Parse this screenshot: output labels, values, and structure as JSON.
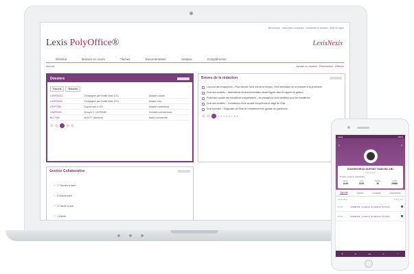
{
  "header": {
    "topline": "Bienvenue · Vous êtes connecté · Contacter le service · Aide en ligne",
    "brand_prefix": "Lexis ",
    "brand_product": "PolyOffice",
    "brand_tm": "®",
    "brand_right_prefix": "Lexis",
    "brand_right_suffix": "Nexis"
  },
  "nav": [
    "Général",
    "Dossier en cours",
    "Tâches",
    "Documentation",
    "Analyse",
    "Compléments"
  ],
  "subbar": {
    "left": "Accueil",
    "right": "Ajouter un module · Réinitialiser · Afficher"
  },
  "dossiers": {
    "title": "Dossiers",
    "tabs": [
      "Favoris",
      "Récents"
    ],
    "rows": [
      [
        "LXNF00001",
        "Compagnie par l'entité Mars (CS)",
        "Dossier courant"
      ],
      [
        "LXNF00002",
        "Compagnie par l'entité Mars (CS)",
        "Dossier clos"
      ],
      [
        "LPRF7000",
        "Dupont sarl c/ SCI",
        "Dossier contentieux"
      ],
      [
        "LXMF5000",
        "Groupe C. LEGRAND",
        "Contrats commerciaux"
      ],
      [
        "BLT7000",
        "MOUTT (Mention)",
        "Statut commercial"
      ]
    ]
  },
  "breves": {
    "title": "Brèves de la rédaction",
    "items": [
      "L'accord des employeurs – Pour assurer l'avis lors de la réunion, il est nécessaire de se préparer à la procédure",
      "Droit des sociétés – Informations environnementales devant figurer dans le rapport de gestion",
      "Protection sociale des travailleurs indépendants – les prestations sont modifiées pour les travailleurs",
      "Droit des sociétés – Constitution d'une société européenne et siège de l'État",
      "Droit bancaire – Diagnostic de l'État de l'endettement en gestion de patrimoine"
    ],
    "pager": [
      "1",
      "2",
      "3",
      "4",
      "5",
      "6",
      "7",
      "8",
      "9"
    ]
  },
  "collab": {
    "title": "Gestion Collaborative",
    "items": [
      "2 Tâches à faire",
      "0 Demandes",
      "0 Tâche à voir",
      "1 Alerte"
    ]
  },
  "phone": {
    "status_left": "●●●●",
    "status_right": "100%",
    "name": "CONTENTIEUX DUPONT TODD ED J.B.I",
    "sub": "Contentieux",
    "sub2": "Dossier ouvert le 12/03/2021",
    "stats": [
      {
        "label": "Statut",
        "value": "Actif"
      },
      {
        "label": "Créé",
        "value": "2016"
      },
      {
        "label": "Tâches",
        "value": "36"
      },
      {
        "label": "Chiffre",
        "value": "29MM"
      }
    ],
    "tabs": [
      "Agenda",
      "Tâches",
      "Contacts",
      "Documents"
    ],
    "section_label": "Aujourd'hui",
    "section_right": "Toutes (19)",
    "rows": [
      {
        "date": "13:30",
        "text": "AUDIENCE – Audience de plaidoirie TGI Paris"
      },
      {
        "date": "15:00",
        "text": "AUDIENCE – Audience de plaidoirie TGI Paris"
      }
    ],
    "bottom_icons": [
      "≡",
      "⌕",
      "▭",
      "✓",
      "⋯"
    ]
  }
}
